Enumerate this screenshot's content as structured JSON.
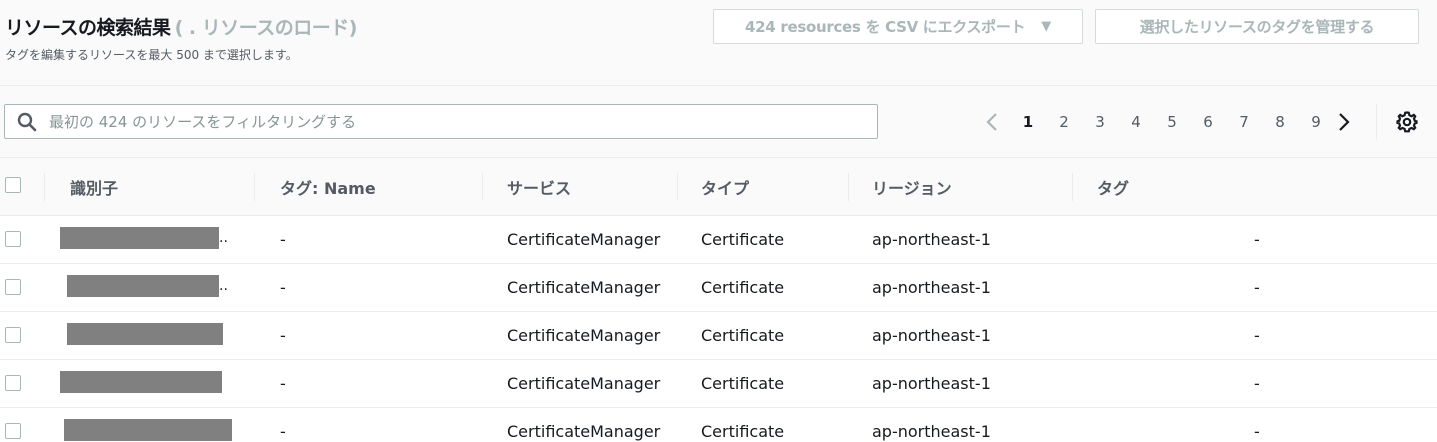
{
  "header": {
    "title": "リソースの検索結果",
    "count_text": "( . リソースのロード)",
    "subtitle": "タグを編集するリソースを最大 500 まで選択します。",
    "export_button": "424 resources を CSV にエクスポート",
    "export_caret": "▼",
    "manage_tags_button": "選択したリソースのタグを管理する"
  },
  "search": {
    "placeholder": "最初の 424 のリソースをフィルタリングする",
    "value": ""
  },
  "pagination": {
    "pages": [
      "1",
      "2",
      "3",
      "4",
      "5",
      "6",
      "7",
      "8",
      "9"
    ],
    "current": "1"
  },
  "table": {
    "columns": [
      "識別子",
      "タグ: Name",
      "サービス",
      "タイプ",
      "リージョン",
      "タグ"
    ],
    "rows": [
      {
        "id_ellipsis": "..",
        "tag_name": "-",
        "service": "CertificateManager",
        "type": "Certificate",
        "region": "ap-northeast-1",
        "tags": "-"
      },
      {
        "id_ellipsis": "..",
        "tag_name": "-",
        "service": "CertificateManager",
        "type": "Certificate",
        "region": "ap-northeast-1",
        "tags": "-"
      },
      {
        "id_ellipsis": "",
        "tag_name": "-",
        "service": "CertificateManager",
        "type": "Certificate",
        "region": "ap-northeast-1",
        "tags": "-"
      },
      {
        "id_ellipsis": "",
        "tag_name": "-",
        "service": "CertificateManager",
        "type": "Certificate",
        "region": "ap-northeast-1",
        "tags": "-"
      },
      {
        "id_ellipsis": "",
        "tag_name": "-",
        "service": "CertificateManager",
        "type": "Certificate",
        "region": "ap-northeast-1",
        "tags": "-"
      }
    ]
  },
  "icons": {
    "search": "search-icon",
    "prev": "chevron-left-icon",
    "next": "chevron-right-icon",
    "settings": "gear-icon"
  },
  "colors": {
    "disabled_text": "#aab7b8",
    "redaction": "#808080",
    "border": "#eaeded"
  }
}
